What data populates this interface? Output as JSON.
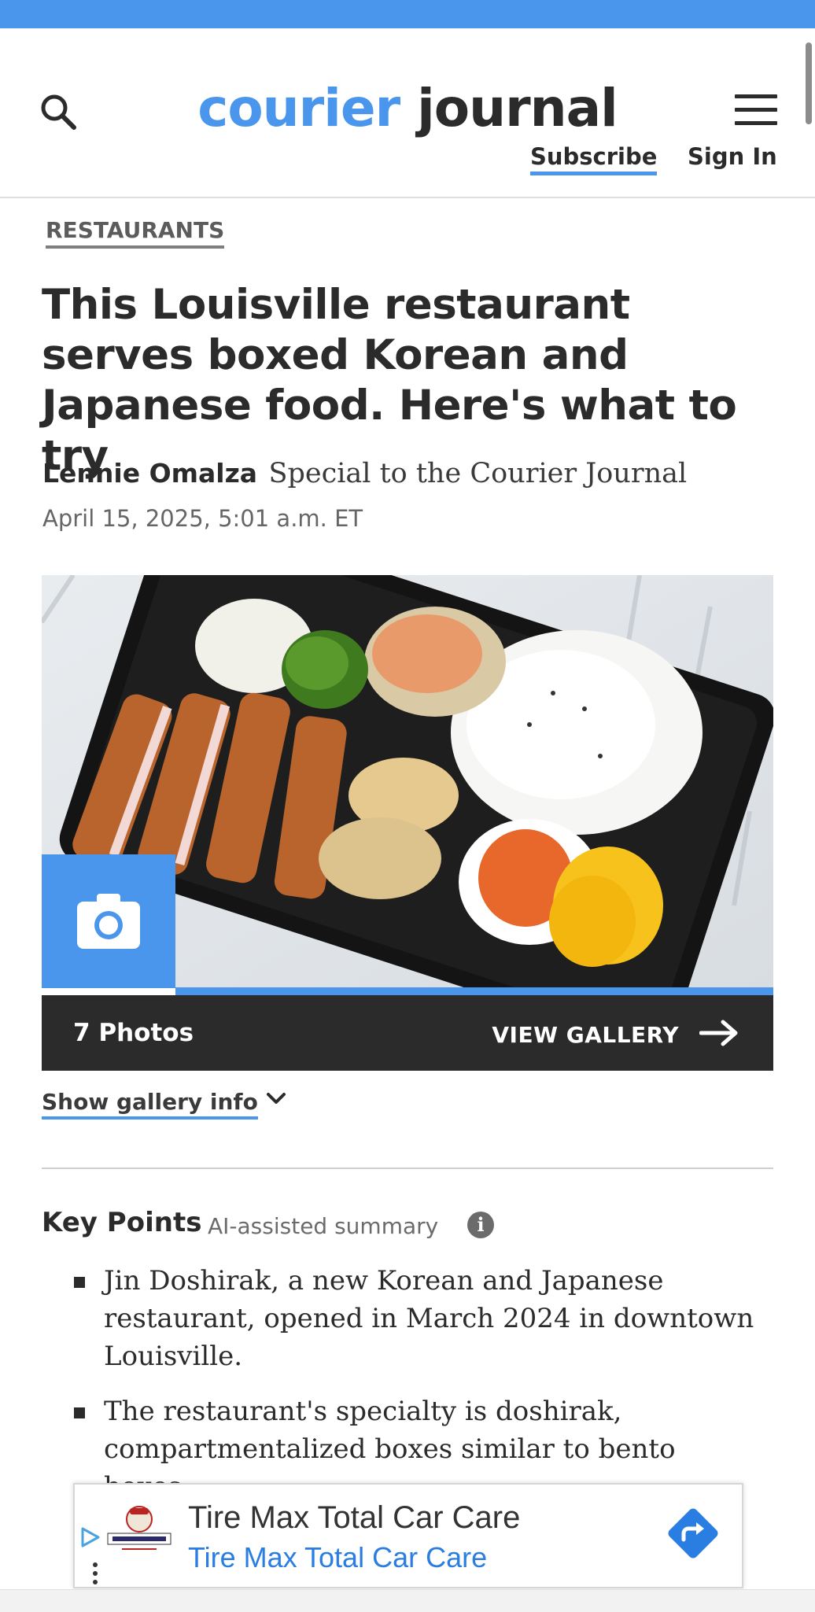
{
  "header": {
    "logo_part1": "courier",
    "logo_part2": "journal",
    "subscribe_label": "Subscribe",
    "signin_label": "Sign In"
  },
  "article": {
    "section": "RESTAURANTS",
    "headline": "This Louisville restaurant serves boxed Korean and Japanese food. Here's what to try",
    "author": "Lennie Omalza",
    "affiliation": "Special to the Courier Journal",
    "date": "April 15, 2025, 5:01 a.m. ET"
  },
  "gallery": {
    "photo_count": "7 Photos",
    "view_label": "VIEW GALLERY",
    "info_label": "Show gallery info"
  },
  "key_points": {
    "title": "Key Points",
    "subtitle": "AI-assisted summary",
    "items": [
      "Jin Doshirak, a new Korean and Japanese restaurant, opened in March 2024 in downtown Louisville.",
      "The restaurant's specialty is doshirak, compartmentalized boxes similar to bento boxes,"
    ]
  },
  "ad": {
    "title": "Tire Max Total Car Care",
    "subtitle": "Tire Max Total Car Care"
  },
  "colors": {
    "brand_blue": "#4a96ec",
    "text_dark": "#2b2b2b",
    "gallery_bar": "#2b2b2b"
  },
  "icons": [
    "search-icon",
    "hamburger-menu-icon",
    "camera-icon",
    "arrow-right-icon",
    "chevron-down-icon",
    "info-icon",
    "adchoices-icon",
    "directions-icon"
  ]
}
